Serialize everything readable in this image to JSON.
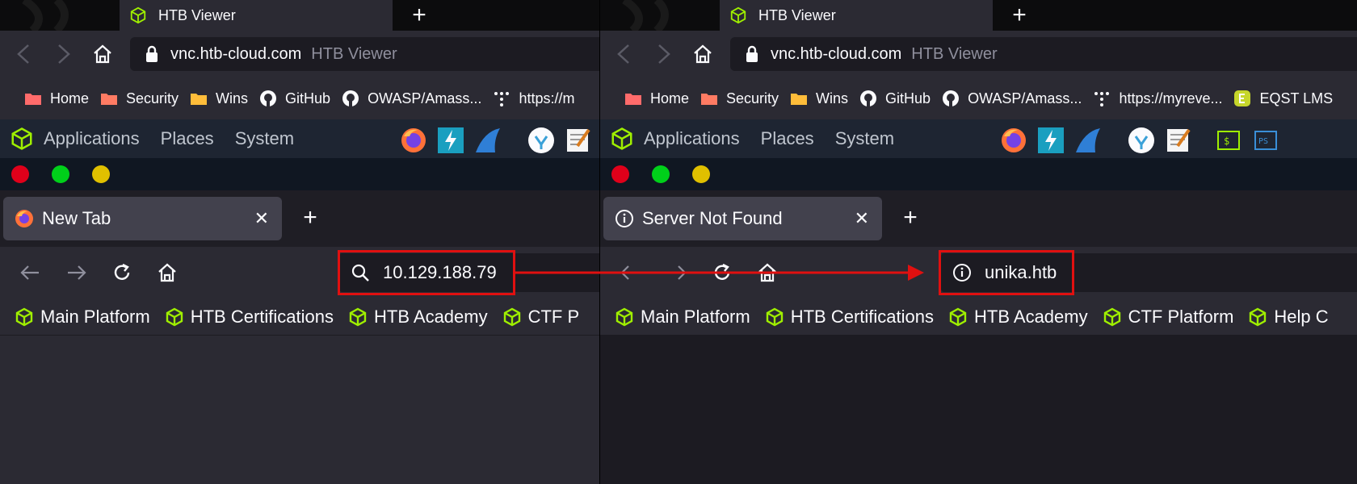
{
  "colors": {
    "htb_green": "#9fef00",
    "annotation_red": "#e01010",
    "traffic_red": "#e0001a",
    "traffic_green": "#00d01a",
    "traffic_yellow": "#e0c000"
  },
  "left": {
    "host": {
      "tab_title": "HTB Viewer",
      "url_domain": "vnc.htb-cloud.com",
      "url_title": "HTB Viewer",
      "bookmarks": [
        {
          "label": "Home",
          "icon": "folder-icon"
        },
        {
          "label": "Security",
          "icon": "folder-icon"
        },
        {
          "label": "Wins",
          "icon": "folder-icon"
        },
        {
          "label": "GitHub",
          "icon": "github-icon"
        },
        {
          "label": "OWASP/Amass...",
          "icon": "github-icon"
        },
        {
          "label": "https://m",
          "icon": "tree-icon"
        }
      ]
    },
    "desktop": {
      "menus": [
        "Applications",
        "Places",
        "System"
      ]
    },
    "firefox": {
      "tab_title": "New Tab",
      "url_text": "10.129.188.79",
      "url_icon": "search-icon",
      "bookmarks": [
        "Main Platform",
        "HTB Certifications",
        "HTB Academy",
        "CTF P"
      ]
    }
  },
  "right": {
    "host": {
      "tab_title": "HTB Viewer",
      "url_domain": "vnc.htb-cloud.com",
      "url_title": "HTB Viewer",
      "bookmarks": [
        {
          "label": "Home",
          "icon": "folder-icon"
        },
        {
          "label": "Security",
          "icon": "folder-icon"
        },
        {
          "label": "Wins",
          "icon": "folder-icon"
        },
        {
          "label": "GitHub",
          "icon": "github-icon"
        },
        {
          "label": "OWASP/Amass...",
          "icon": "github-icon"
        },
        {
          "label": "https://myreve...",
          "icon": "tree-icon"
        },
        {
          "label": "EQST LMS",
          "icon": "eqst-icon"
        }
      ]
    },
    "desktop": {
      "menus": [
        "Applications",
        "Places",
        "System"
      ]
    },
    "firefox": {
      "tab_title": "Server Not Found",
      "url_text": "unika.htb",
      "url_icon": "info-icon",
      "bookmarks": [
        "Main Platform",
        "HTB Certifications",
        "HTB Academy",
        "CTF Platform",
        "Help C"
      ]
    }
  }
}
